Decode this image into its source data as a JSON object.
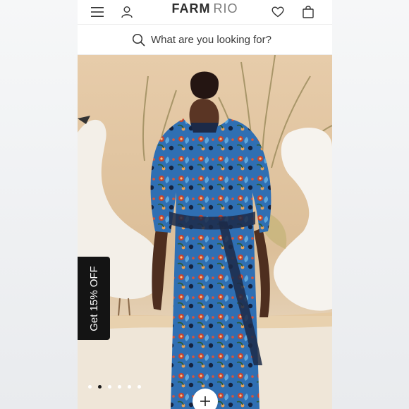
{
  "header": {
    "logo_primary": "FARM",
    "logo_secondary": "RIO",
    "icons": [
      "menu-icon",
      "user-icon",
      "heart-icon",
      "bag-icon"
    ]
  },
  "search": {
    "placeholder": "What are you looking for?"
  },
  "promo": {
    "label": "Get 15% OFF"
  },
  "carousel": {
    "slide_count": 6,
    "active_index": 1
  },
  "colors": {
    "background_side": "#eef0f2",
    "promo_tab": "#141414",
    "text": "#333333",
    "dress_blue": "#3c7fc4",
    "dress_navy": "#1c2a48"
  }
}
